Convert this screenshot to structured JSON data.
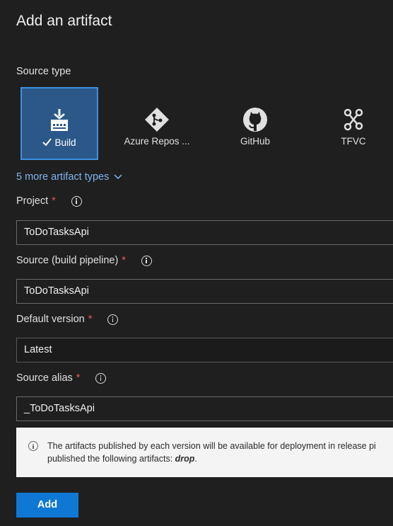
{
  "dialog": {
    "title": "Add an artifact"
  },
  "source_type": {
    "label": "Source type",
    "tiles": [
      {
        "label": "Build",
        "icon": "build-icon",
        "selected": true
      },
      {
        "label": "Azure Repos ...",
        "icon": "azure-repos-icon",
        "selected": false
      },
      {
        "label": "GitHub",
        "icon": "github-icon",
        "selected": false
      },
      {
        "label": "TFVC",
        "icon": "tfvc-icon",
        "selected": false
      }
    ],
    "more_link": "5 more artifact types"
  },
  "fields": {
    "project": {
      "label": "Project",
      "required": "*",
      "value": "ToDoTasksApi"
    },
    "source": {
      "label": "Source (build pipeline)",
      "required": "*",
      "value": "ToDoTasksApi"
    },
    "default_version": {
      "label": "Default version",
      "required": "*",
      "value": "Latest"
    },
    "source_alias": {
      "label": "Source alias",
      "required": "*",
      "value": "_ToDoTasksApi"
    }
  },
  "notice": {
    "line1": "The artifacts published by each version will be available for deployment in release pi",
    "line2_prefix": "published the following artifacts: ",
    "line2_artifact": "drop",
    "line2_suffix": "."
  },
  "actions": {
    "add_label": "Add"
  },
  "colors": {
    "accent": "#0f78d4",
    "selected_tile": "#2b5888",
    "link": "#7fb4f0",
    "required": "#e05a5a"
  }
}
